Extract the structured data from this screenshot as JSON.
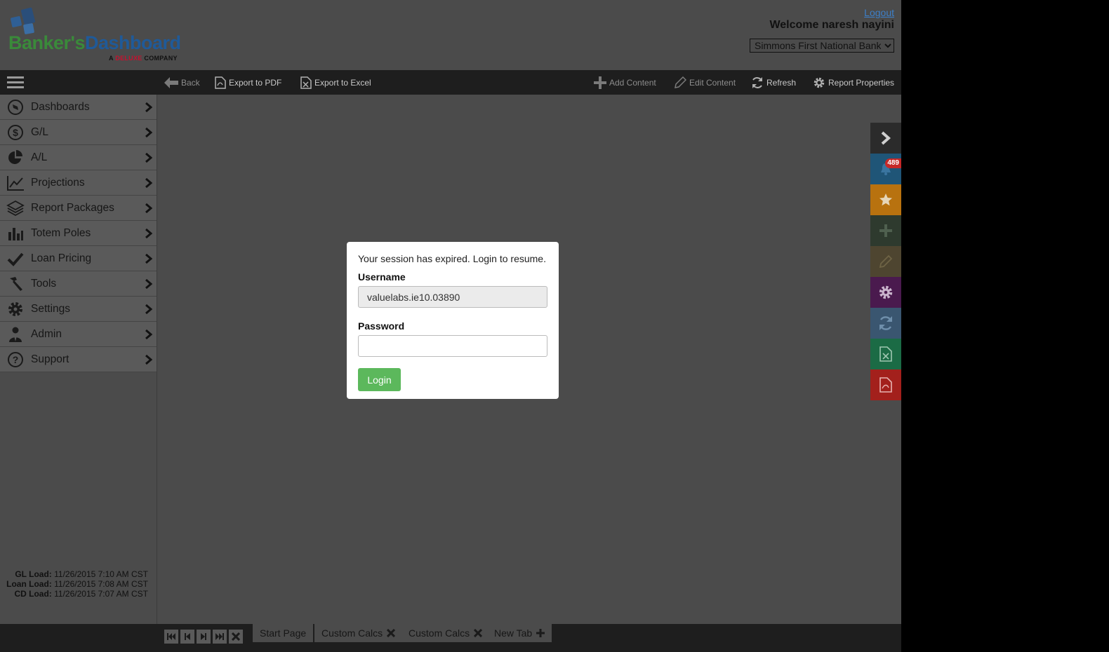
{
  "header": {
    "logo_word1": "Banker's",
    "logo_word2": "Dashboard",
    "logo_sub_prefix": "A ",
    "logo_sub_brand": "DELUXE",
    "logo_sub_suffix": " COMPANY",
    "logout": "Logout",
    "welcome": "Welcome  naresh nayini",
    "bank_selected": "Simmons First National Bank"
  },
  "toolbar": {
    "back": "Back",
    "export_pdf": "Export to PDF",
    "export_excel": "Export to Excel",
    "add_content": "Add Content",
    "edit_content": "Edit Content",
    "refresh": "Refresh",
    "report_properties": "Report Properties"
  },
  "sidebar": {
    "items": [
      {
        "label": "Dashboards",
        "icon": "compass-icon"
      },
      {
        "label": "G/L",
        "icon": "dollar-circle-icon"
      },
      {
        "label": "A/L",
        "icon": "pie-chart-icon"
      },
      {
        "label": "Projections",
        "icon": "line-chart-icon"
      },
      {
        "label": "Report Packages",
        "icon": "layers-icon"
      },
      {
        "label": "Totem Poles",
        "icon": "bar-chart-icon"
      },
      {
        "label": "Loan Pricing",
        "icon": "checkmark-icon"
      },
      {
        "label": "Tools",
        "icon": "hammer-icon"
      },
      {
        "label": "Settings",
        "icon": "gear-icon"
      },
      {
        "label": "Admin",
        "icon": "user-tie-icon"
      },
      {
        "label": "Support",
        "icon": "question-circle-icon"
      }
    ]
  },
  "loads": {
    "gl_label": "GL Load:",
    "gl_value": "11/26/2015 7:10 AM CST",
    "loan_label": "Loan Load:",
    "loan_value": "11/26/2015 7:08 AM CST",
    "cd_label": "CD Load:",
    "cd_value": "11/26/2015 7:07 AM CST"
  },
  "rail": {
    "notification_count": "489",
    "colors": [
      "#2b2b2b",
      "#1f5577",
      "#b8720f",
      "#2e3a2e",
      "#4e4530",
      "#4a1a4e",
      "#3a5670",
      "#1b6b45",
      "#a3201c"
    ]
  },
  "modal": {
    "message": "Your session has expired. Login to resume.",
    "username_label": "Username",
    "username_value": "valuelabs.ie10.03890",
    "password_label": "Password",
    "password_value": "",
    "login_button": "Login"
  },
  "footer": {
    "tabs": [
      {
        "label": "Start Page"
      },
      {
        "label": "Custom Calcs"
      },
      {
        "label": "Custom Calcs"
      },
      {
        "label": "New Tab"
      }
    ]
  }
}
